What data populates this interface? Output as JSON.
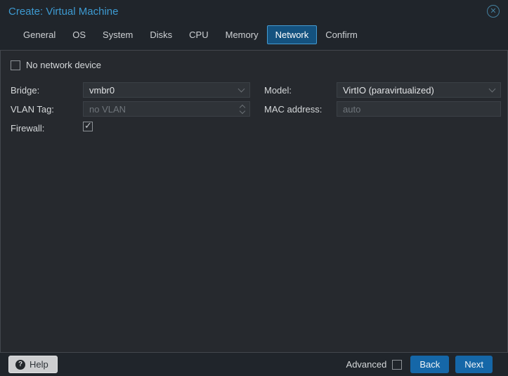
{
  "window": {
    "title": "Create: Virtual Machine",
    "close_icon": "✕"
  },
  "tabs": {
    "items": [
      {
        "label": "General",
        "active": false
      },
      {
        "label": "OS",
        "active": false
      },
      {
        "label": "System",
        "active": false
      },
      {
        "label": "Disks",
        "active": false
      },
      {
        "label": "CPU",
        "active": false
      },
      {
        "label": "Memory",
        "active": false
      },
      {
        "label": "Network",
        "active": true
      },
      {
        "label": "Confirm",
        "active": false
      }
    ]
  },
  "form": {
    "no_network_device": {
      "label": "No network device",
      "checked": false
    },
    "bridge": {
      "label": "Bridge:",
      "value": "vmbr0"
    },
    "vlan_tag": {
      "label": "VLAN Tag:",
      "placeholder": "no VLAN",
      "value": ""
    },
    "firewall": {
      "label": "Firewall:",
      "checked": true
    },
    "model": {
      "label": "Model:",
      "value": "VirtIO (paravirtualized)"
    },
    "mac_address": {
      "label": "MAC address:",
      "placeholder": "auto",
      "value": ""
    }
  },
  "footer": {
    "help_label": "Help",
    "help_icon": "?",
    "advanced_label": "Advanced",
    "advanced_checked": false,
    "back_label": "Back",
    "next_label": "Next"
  },
  "colors": {
    "title_blue": "#3d9ad1",
    "active_tab_bg": "#14527f",
    "active_tab_border": "#459bd1",
    "button_blue": "#1567a8",
    "panel_bg": "#26292e",
    "field_bg": "#2f3338",
    "placeholder_gray": "#6f757b"
  }
}
